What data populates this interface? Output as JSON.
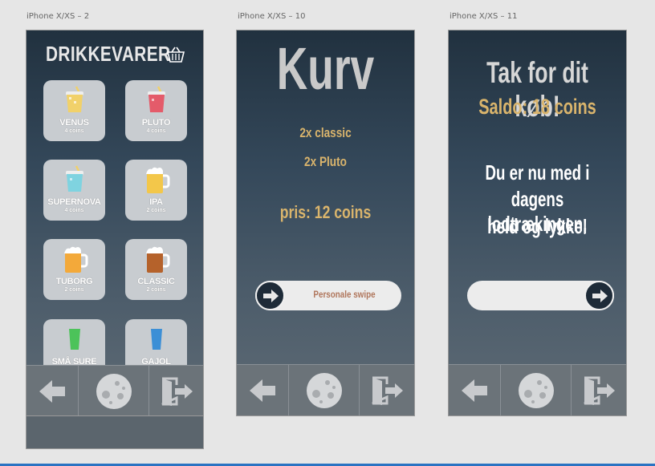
{
  "artboards": [
    {
      "label": "iPhone X/XS – 2"
    },
    {
      "label": "iPhone X/XS – 10"
    },
    {
      "label": "iPhone X/XS – 11"
    }
  ],
  "drinks_screen": {
    "title": "DRIKKEVARER",
    "cart_icon": "basket-icon",
    "items": [
      {
        "name": "VENUS",
        "price": "4 coins",
        "icon": "cocktail-yellow-icon",
        "color": "#f1d16a"
      },
      {
        "name": "PLUTO",
        "price": "4 coins",
        "icon": "cocktail-red-icon",
        "color": "#e45b6a"
      },
      {
        "name": "SUPERNOVA",
        "price": "4 coins",
        "icon": "cocktail-blue-icon",
        "color": "#7fd3e0"
      },
      {
        "name": "IPA",
        "price": "2 coins",
        "icon": "beer-mug-icon",
        "color": "#f3c74a"
      },
      {
        "name": "TUBORG",
        "price": "2 coins",
        "icon": "beer-mug-icon",
        "color": "#f3a93a"
      },
      {
        "name": "CLASSIC",
        "price": "2 coins",
        "icon": "beer-mug-dark-icon",
        "color": "#b5622b"
      },
      {
        "name": "SMÅ SURE",
        "price": "",
        "icon": "shot-green-icon",
        "color": "#4cc35a"
      },
      {
        "name": "GAJOL",
        "price": "",
        "icon": "shot-blue-icon",
        "color": "#3c8fd6"
      }
    ]
  },
  "basket_screen": {
    "title": "Kurv",
    "lines": [
      "2x classic",
      "2x Pluto"
    ],
    "price": "pris: 12 coins",
    "swipe_label": "Personale swipe"
  },
  "thanks_screen": {
    "title": "Tak for dit køb!",
    "balance": "Saldo: 18 coins",
    "message_line1": "Du er nu med i",
    "message_line2": "dagens lodtrækingen,",
    "message_line3": "held og lykke!"
  },
  "nav": {
    "back_icon": "back-arrow-icon",
    "center_icon": "moon-icon",
    "exit_icon": "exit-door-icon"
  },
  "colors": {
    "accent_gold": "#d9b46c",
    "swipe_bar": "#ececec",
    "tile_bg": "#c8ccd0"
  }
}
